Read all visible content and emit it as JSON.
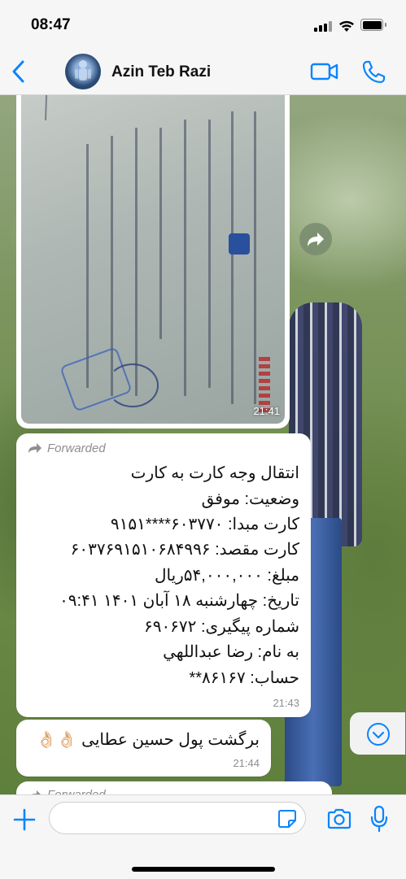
{
  "status_bar": {
    "time": "08:47"
  },
  "header": {
    "chat_name": "Azin Teb Razi",
    "icons": {
      "back": "chevron-left-icon",
      "video": "video-camera-icon",
      "call": "phone-icon"
    },
    "accent_color": "#0a84ff"
  },
  "messages": [
    {
      "type": "image",
      "time": "21:41",
      "icon": "forward-icon"
    },
    {
      "type": "text",
      "forwarded_label": "Forwarded",
      "lines": [
        "انتقال وجه کارت به کارت",
        "وضعیت: موفق",
        "کارت مبدا: ۶۰۳۷۷۰****۹۱۵۱",
        "کارت مقصد: ۶۰۳۷۶۹۱۵۱۰۶۸۴۹۹۶",
        "مبلغ: ۵۴,۰۰۰,۰۰۰ریال",
        "تاریخ: چهارشنبه ۱۸ آبان ۱۴۰۱ ۰۹:۴۱",
        "شماره پیگیری: ۶۹۰۶۷۲",
        "به نام: رضا عبداللهي",
        "حساب: ۸۶۱۶۷**"
      ],
      "time": "21:43"
    },
    {
      "type": "text",
      "text": "برگشت پول حسین عطایی 👌🏻👌🏻",
      "time": "21:44"
    },
    {
      "type": "text",
      "forwarded_label": "Forwarded"
    }
  ],
  "input_bar": {
    "placeholder": "",
    "icons": {
      "attach": "plus-icon",
      "sticker": "sticker-icon",
      "camera": "camera-icon",
      "mic": "microphone-icon"
    }
  },
  "colors": {
    "bubble": "#ffffff",
    "meta_text": "#8e8e93",
    "bar_bg": "#f6f6f6"
  }
}
